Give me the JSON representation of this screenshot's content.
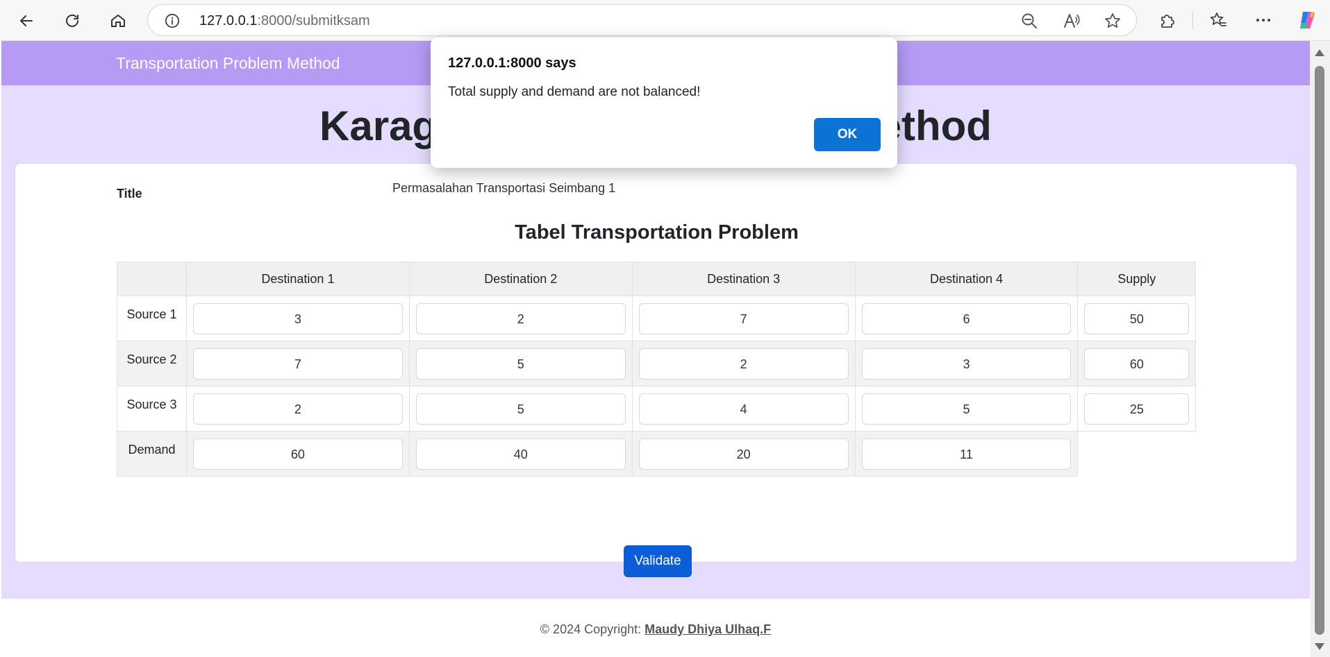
{
  "browser": {
    "url_host": "127.0.0.1",
    "url_rest": ":8000/submitksam"
  },
  "navbar": {
    "brand": "Transportation Problem Method"
  },
  "page": {
    "heading": "Karaguel Seimbang Asian Method",
    "title_label": "Title",
    "title_value": "Permasalahan Transportasi Seimbang 1",
    "table_heading": "Tabel Transportation Problem"
  },
  "table": {
    "headers": [
      "Destination 1",
      "Destination 2",
      "Destination 3",
      "Destination 4",
      "Supply"
    ],
    "rows": [
      {
        "label": "Source 1",
        "values": [
          "3",
          "2",
          "7",
          "6",
          "50"
        ]
      },
      {
        "label": "Source 2",
        "values": [
          "7",
          "5",
          "2",
          "3",
          "60"
        ]
      },
      {
        "label": "Source 3",
        "values": [
          "2",
          "5",
          "4",
          "5",
          "25"
        ]
      }
    ],
    "demand": {
      "label": "Demand",
      "values": [
        "60",
        "40",
        "20",
        "11"
      ]
    }
  },
  "validate_label": "Validate",
  "footer": {
    "prefix": "© 2024 Copyright: ",
    "author": "Maudy Dhiya Ulhaq.F"
  },
  "dialog": {
    "title": "127.0.0.1:8000 says",
    "message": "Total supply and demand are not balanced!",
    "ok_label": "OK"
  },
  "colors": {
    "navbar": "#b69af4",
    "page_bg": "#e5dcff",
    "button_primary": "#0b5ed7",
    "dialog_ok": "#0b72d6"
  },
  "icons": {
    "back": "arrow-left-icon",
    "refresh": "refresh-icon",
    "home": "home-icon",
    "info": "info-icon",
    "zoom": "zoom-out-icon",
    "read_aloud": "read-aloud-icon",
    "favorite": "star-icon",
    "extensions": "puzzle-icon",
    "favorites": "favorites-icon",
    "more": "more-icon",
    "copilot": "copilot-icon"
  }
}
